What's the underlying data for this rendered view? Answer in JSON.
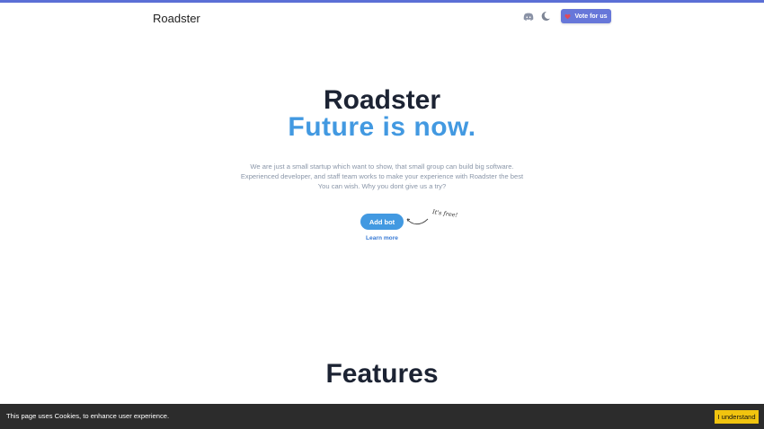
{
  "nav": {
    "brand": "Roadster",
    "icons": [
      "discord-icon",
      "moon-icon"
    ],
    "vote_label": "Vote for us"
  },
  "hero": {
    "title": "Roadster",
    "tagline": "Future is now.",
    "description": "We are just a small startup which want to show, that small group can build big software. Experienced developer, and staff team works to make your experience with Roadster the best You can wish. Why you dont give us a try?",
    "add_bot_label": "Add bot",
    "free_note": "It's free!",
    "learn_more_label": "Learn more"
  },
  "features": {
    "heading": "Features"
  },
  "cookie": {
    "message": "This page uses Cookies, to enhance user experience.",
    "accept_label": "I understand"
  },
  "colors": {
    "accent_bar": "#5b6fd6",
    "vote_button": "#6777d9",
    "primary_blue": "#4299e1",
    "cookie_button": "#f1c40f",
    "cookie_bar": "#2c2c2c"
  }
}
